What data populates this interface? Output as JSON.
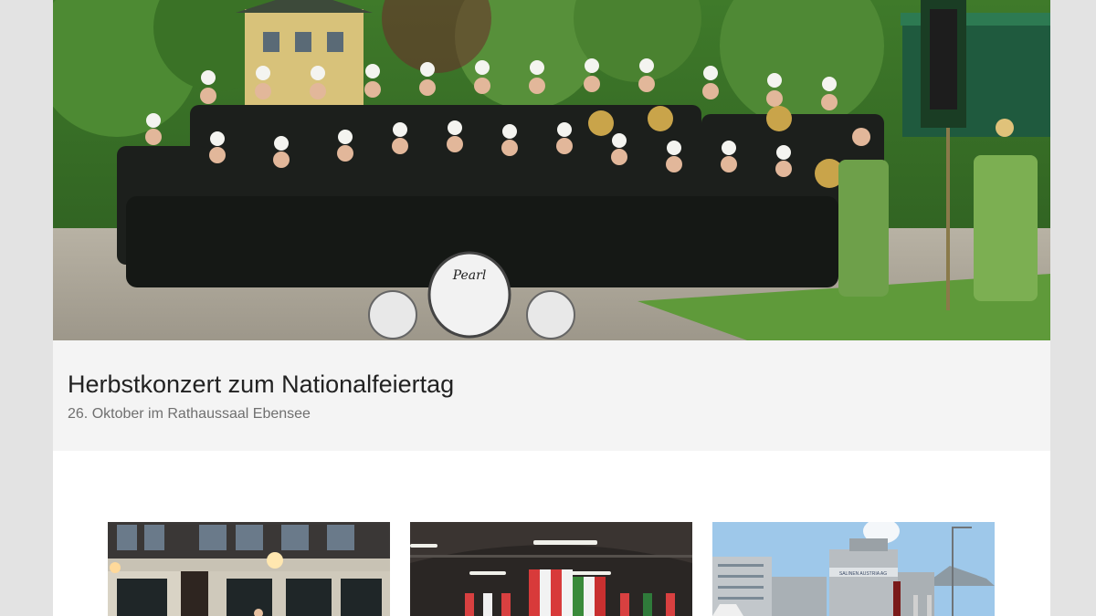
{
  "hero": {
    "photo_description_icon": "band-group-photo",
    "drum_brand": "Pearl",
    "title": "Herbstkonzert zum Nationalfeiertag",
    "subtitle": "26. Oktober im Rathaussaal Ebensee"
  },
  "teasers": [
    {
      "icon": "night-building-photo"
    },
    {
      "icon": "festival-hall-photo"
    },
    {
      "icon": "outdoor-building-photo",
      "sign_text": "SALINEN AUSTRIA AG"
    }
  ],
  "colors": {
    "page_background": "#e3e3e3",
    "content_background": "#ffffff",
    "caption_background": "#f4f4f4",
    "title_color": "#222222",
    "subtitle_color": "#6f6f6f"
  }
}
